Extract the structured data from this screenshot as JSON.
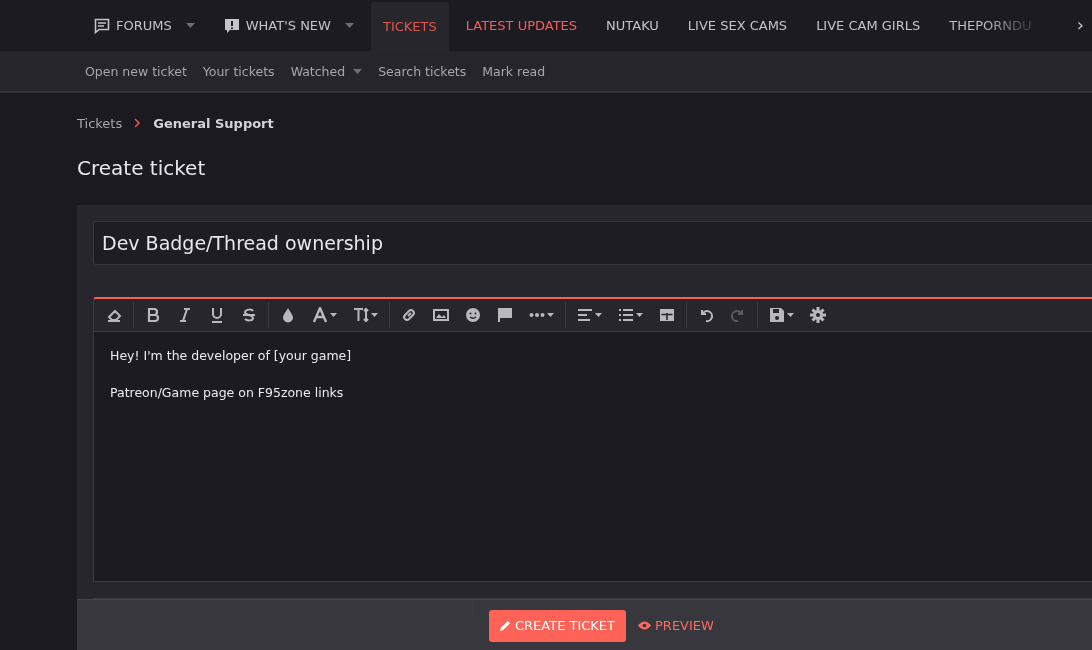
{
  "nav": {
    "items": [
      {
        "label": "FORUMS",
        "kind": "forums",
        "dropdown": true,
        "selected": false,
        "highlight": false
      },
      {
        "label": "WHAT'S NEW",
        "kind": "whatsnew",
        "dropdown": true,
        "selected": false,
        "highlight": false
      },
      {
        "label": "TICKETS",
        "kind": "plain",
        "dropdown": false,
        "selected": true,
        "highlight": false
      },
      {
        "label": "LATEST UPDATES",
        "kind": "plain",
        "dropdown": false,
        "selected": false,
        "highlight": true
      },
      {
        "label": "NUTAKU",
        "kind": "plain",
        "dropdown": false,
        "selected": false,
        "highlight": false
      },
      {
        "label": "LIVE SEX CAMS",
        "kind": "plain",
        "dropdown": false,
        "selected": false,
        "highlight": false
      },
      {
        "label": "LIVE CAM GIRLS",
        "kind": "plain",
        "dropdown": false,
        "selected": false,
        "highlight": false
      },
      {
        "label": "THEPORNDU",
        "kind": "faded",
        "dropdown": false,
        "selected": false,
        "highlight": false
      }
    ],
    "scroll_arrow": "›"
  },
  "subnav": [
    {
      "label": "Open new ticket",
      "dropdown": false
    },
    {
      "label": "Your tickets",
      "dropdown": false
    },
    {
      "label": "Watched",
      "dropdown": true
    },
    {
      "label": "Search tickets",
      "dropdown": false
    },
    {
      "label": "Mark read",
      "dropdown": false
    }
  ],
  "breadcrumb": [
    "Tickets",
    "General Support"
  ],
  "page_title": "Create ticket",
  "form": {
    "title_value": "Dev Badge/Thread ownership",
    "toolbar": [
      [
        {
          "kind": "eraser",
          "dropdown": false,
          "disabled": false
        }
      ],
      [
        {
          "kind": "bold",
          "dropdown": false,
          "disabled": false
        },
        {
          "kind": "italic",
          "dropdown": false,
          "disabled": false
        },
        {
          "kind": "underline",
          "dropdown": false,
          "disabled": false
        },
        {
          "kind": "strike",
          "dropdown": false,
          "disabled": false
        }
      ],
      [
        {
          "kind": "color",
          "dropdown": false,
          "disabled": false
        },
        {
          "kind": "font",
          "dropdown": true,
          "disabled": false
        },
        {
          "kind": "size",
          "dropdown": true,
          "disabled": false
        }
      ],
      [
        {
          "kind": "link",
          "dropdown": false,
          "disabled": false
        },
        {
          "kind": "image",
          "dropdown": false,
          "disabled": false
        },
        {
          "kind": "smiley",
          "dropdown": false,
          "disabled": false
        },
        {
          "kind": "flag",
          "dropdown": false,
          "disabled": false
        },
        {
          "kind": "more",
          "dropdown": true,
          "disabled": false
        }
      ],
      [
        {
          "kind": "align",
          "dropdown": true,
          "disabled": false
        },
        {
          "kind": "list",
          "dropdown": true,
          "disabled": false
        },
        {
          "kind": "table",
          "dropdown": false,
          "disabled": false
        }
      ],
      [
        {
          "kind": "undo",
          "dropdown": false,
          "disabled": false
        },
        {
          "kind": "redo",
          "dropdown": false,
          "disabled": true
        }
      ],
      [
        {
          "kind": "save",
          "dropdown": true,
          "disabled": false
        },
        {
          "kind": "gear",
          "dropdown": false,
          "disabled": false
        }
      ]
    ],
    "body": [
      "Hey! I'm the developer of [your game]",
      "Patreon/Game page on F95zone links"
    ],
    "buttons": [
      {
        "label": "CREATE TICKET",
        "kind": "primary"
      },
      {
        "label": "PREVIEW",
        "kind": "link"
      }
    ]
  }
}
